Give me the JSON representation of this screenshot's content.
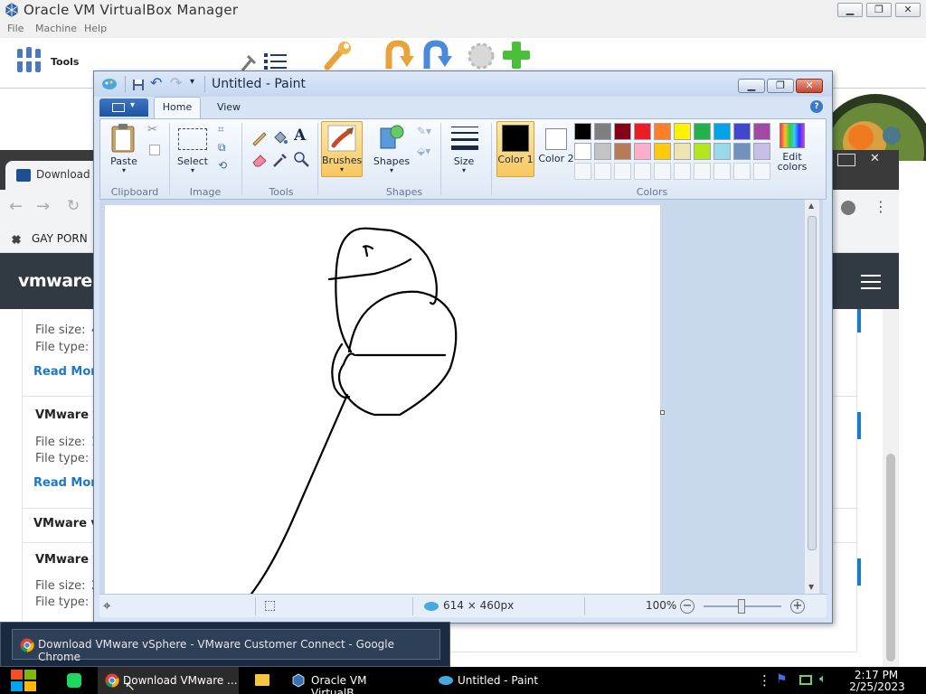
{
  "vbox": {
    "title": "Oracle VM VirtualBox Manager",
    "menu": [
      "File",
      "Machine",
      "Help"
    ],
    "tools_label": "Tools"
  },
  "chrome": {
    "tab_title": "Download V",
    "bookmark": "GAY PORN",
    "site_logo": "vmware",
    "content": {
      "file_size_label": "File size:",
      "file_type_label": "File type:",
      "read_more": "Read More",
      "item_heading": "VMware v",
      "item_heading_2": "VMware v",
      "size_suffix_1": "4",
      "size_suffix_2": "1",
      "size_suffix_3": "2"
    }
  },
  "paint": {
    "title": "Untitled - Paint",
    "tabs": [
      "Home",
      "View"
    ],
    "groups": {
      "clipboard": "Clipboard",
      "image": "Image",
      "tools": "Tools",
      "shapes": "Shapes",
      "colors": "Colors"
    },
    "buttons": {
      "paste": "Paste",
      "select": "Select",
      "brushes": "Brushes",
      "shapes": "Shapes",
      "size": "Size",
      "color1": "Color 1",
      "color2": "Color 2",
      "edit_colors": "Edit colors"
    },
    "palette_row1": [
      "#000000",
      "#7f7f7f",
      "#880015",
      "#ed1c24",
      "#ff7f27",
      "#fff200",
      "#22b14c",
      "#00a2e8",
      "#3f48cc",
      "#a349a4"
    ],
    "palette_row2": [
      "#ffffff",
      "#c3c3c3",
      "#b97a57",
      "#ffaec9",
      "#ffc90e",
      "#efe4b0",
      "#b5e61d",
      "#99d9ea",
      "#7092be",
      "#c8bfe7"
    ],
    "color1_value": "#000000",
    "color2_value": "#ffffff",
    "status": {
      "canvas_size": "614 × 460px",
      "zoom": "100%"
    }
  },
  "tooltip": {
    "text": "Download VMware vSphere - VMware Customer Connect - Google Chrome"
  },
  "taskbar": {
    "items": [
      {
        "label": "Download VMware ..."
      },
      {
        "label": "Oracle VM VirtualB..."
      },
      {
        "label": "Untitled - Paint"
      }
    ],
    "time": "2:17 PM",
    "date": "2/25/2023"
  }
}
